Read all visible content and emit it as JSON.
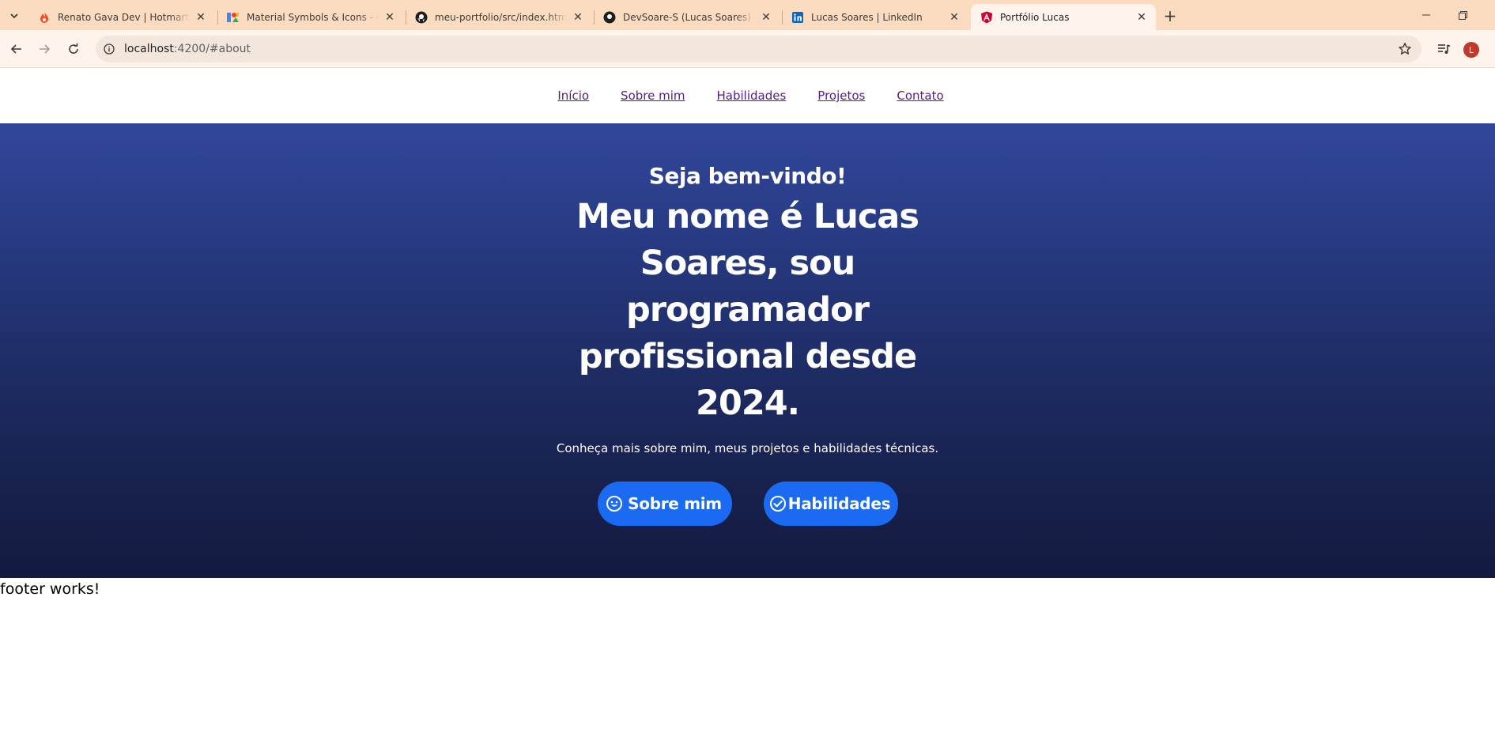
{
  "browser": {
    "tabs": [
      {
        "title": "Renato Gava Dev | Hotmart Club",
        "favicon": "hotmart-flame-icon"
      },
      {
        "title": "Material Symbols & Icons - Google Fonts",
        "favicon": "google-fonts-icon"
      },
      {
        "title": "meu-portfolio/src/index.html at main",
        "favicon": "github-icon"
      },
      {
        "title": "DevSoare-S (Lucas Soares)",
        "favicon": "github-icon"
      },
      {
        "title": "Lucas Soares | LinkedIn",
        "favicon": "linkedin-icon"
      },
      {
        "title": "Portfólio Lucas",
        "favicon": "angular-icon",
        "active": true
      }
    ],
    "address": {
      "host": "localhost",
      "rest": ":4200/#about"
    },
    "profile_initial": "L",
    "colors": {
      "tabstrip": "#fbdcc0",
      "toolbar": "#fff4ec"
    }
  },
  "site": {
    "nav": [
      "Início",
      "Sobre mim",
      "Habilidades",
      "Projetos",
      "Contato"
    ],
    "hero": {
      "welcome": "Seja bem-vindo!",
      "headline": "Meu nome é Lucas Soares, sou programador profissional desde 2024.",
      "subtitle": "Conheça mais sobre mim, meus projetos e habilidades técnicas.",
      "buttons": [
        {
          "label": "Sobre mim",
          "icon": "smiley-face-icon"
        },
        {
          "label": "Habilidades",
          "icon": "check-circle-icon"
        }
      ]
    },
    "footer": "footer works!",
    "colors": {
      "button": "#1b6bf2",
      "hero_top": "#31479c",
      "hero_bottom": "#131a3e",
      "link": "#551a8b"
    }
  }
}
